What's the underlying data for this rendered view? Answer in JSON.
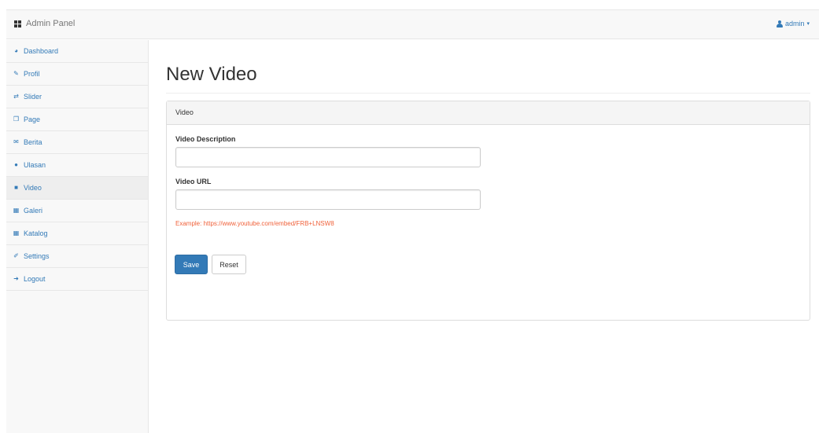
{
  "navbar": {
    "brand": "Admin Panel",
    "user": "admin"
  },
  "sidebar": {
    "items": [
      {
        "label": "Dashboard",
        "icon": "dashboard-icon"
      },
      {
        "label": "Profil",
        "icon": "edit-icon"
      },
      {
        "label": "Slider",
        "icon": "slider-icon"
      },
      {
        "label": "Page",
        "icon": "page-icon"
      },
      {
        "label": "Berita",
        "icon": "news-icon"
      },
      {
        "label": "Ulasan",
        "icon": "comment-icon"
      },
      {
        "label": "Video",
        "icon": "video-icon"
      },
      {
        "label": "Galeri",
        "icon": "gallery-icon"
      },
      {
        "label": "Katalog",
        "icon": "catalog-icon"
      },
      {
        "label": "Settings",
        "icon": "wrench-icon"
      },
      {
        "label": "Logout",
        "icon": "logout-icon"
      }
    ]
  },
  "main": {
    "title": "New Video",
    "panel_heading": "Video",
    "description_label": "Video Description",
    "description_value": "",
    "url_label": "Video URL",
    "url_value": "",
    "help_text": "Example: https://www.youtube.com/embed/FRB+LNSW8",
    "save_label": "Save",
    "reset_label": "Reset"
  },
  "colors": {
    "accent": "#337ab7",
    "help": "#f0623b"
  }
}
